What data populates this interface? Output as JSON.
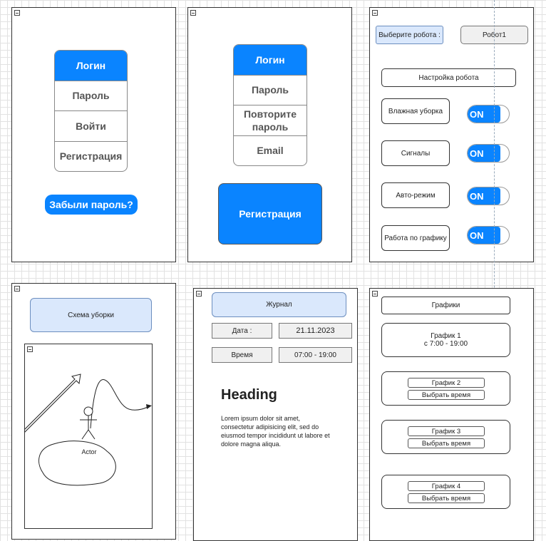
{
  "screen_login": {
    "login": "Логин",
    "password": "Пароль",
    "enter": "Войти",
    "register": "Регистрация",
    "forgot": "Забыли пароль?"
  },
  "screen_register": {
    "login": "Логин",
    "password": "Пароль",
    "repeat_password": "Повторите пароль",
    "email": "Email",
    "register_button": "Регистрация"
  },
  "screen_settings": {
    "choose_robot_label": "Выберите робота :",
    "robot_value": "Робот1",
    "robot_setup": "Настройка робота",
    "options": [
      {
        "label": "Влажная уборка",
        "toggle": "ON"
      },
      {
        "label": "Сигналы",
        "toggle": "ON"
      },
      {
        "label": "Авто-режим",
        "toggle": "ON"
      },
      {
        "label": "Работа по графику",
        "toggle": "ON"
      }
    ]
  },
  "screen_scheme": {
    "title": "Схема уборки",
    "actor_label": "Actor"
  },
  "screen_journal": {
    "title": "Журнал",
    "date_label": "Дата :",
    "date_value": "21.11.2023",
    "time_label": "Время",
    "time_value": "07:00 - 19:00",
    "heading": "Heading",
    "body": "Lorem ipsum dolor sit amet, consectetur adipisicing elit, sed do eiusmod tempor incididunt ut labore et dolore magna aliqua."
  },
  "screen_schedules": {
    "title": "Графики",
    "schedule1_title": "График 1",
    "schedule1_time": "с 7:00 - 19:00",
    "schedules": [
      {
        "title": "График 2",
        "button": "Выбрать время"
      },
      {
        "title": "График 3",
        "button": "Выбрать время"
      },
      {
        "title": "График 4",
        "button": "Выбрать время"
      }
    ]
  },
  "colors": {
    "accent": "#0a84ff",
    "light_fill": "#dae8fc",
    "light_stroke": "#6c8ebf",
    "field_fill": "#f0f0f0"
  }
}
